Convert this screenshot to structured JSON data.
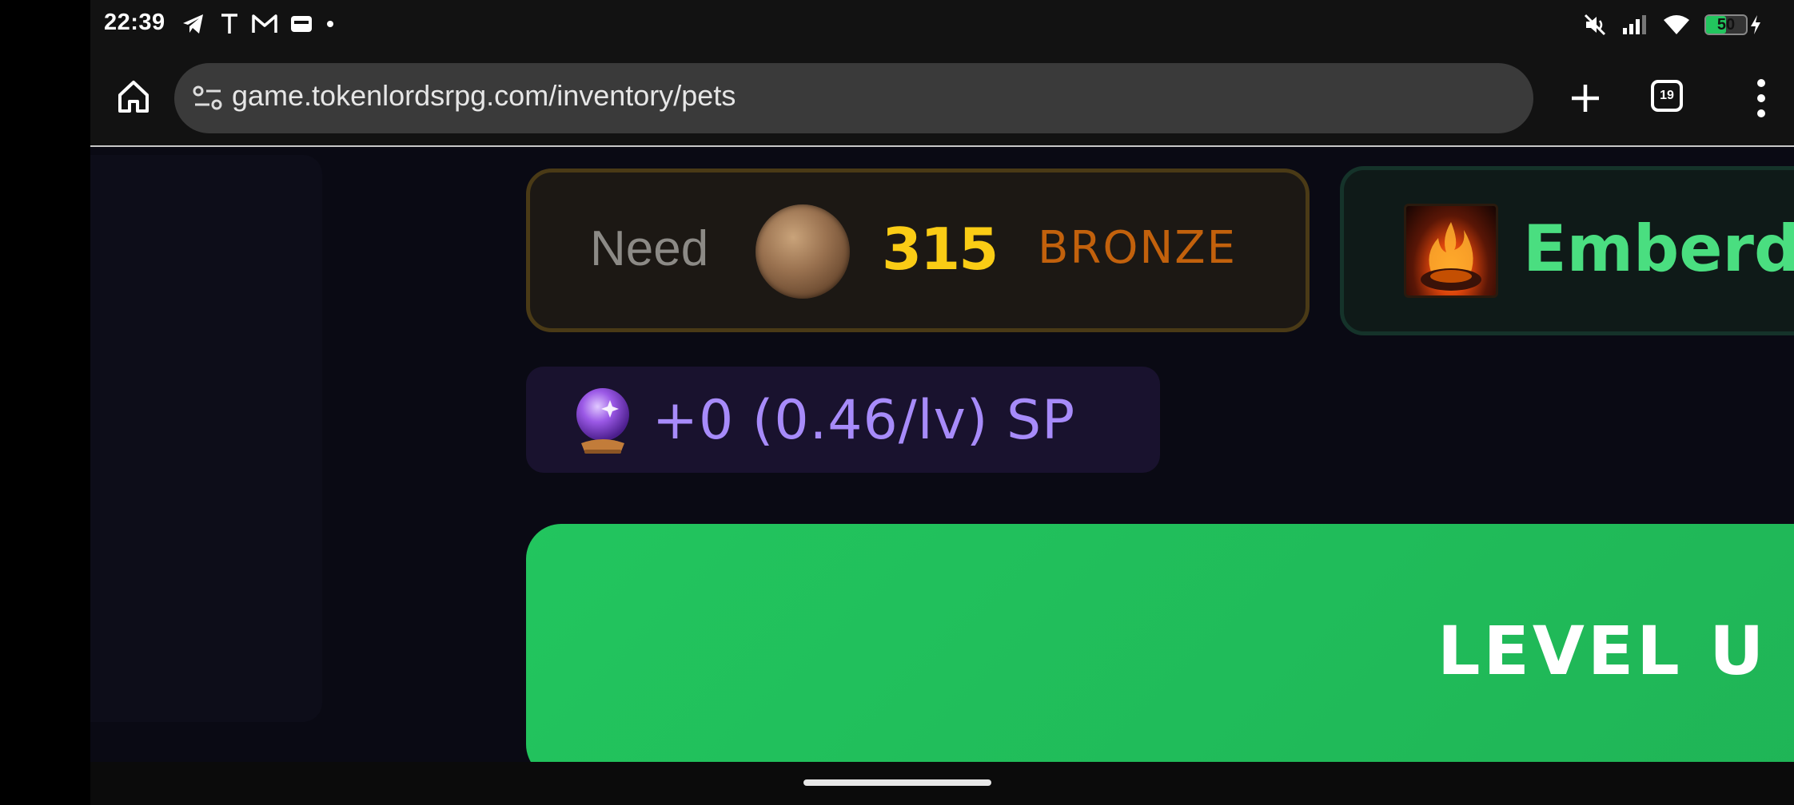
{
  "status_bar": {
    "time": "22:39",
    "notification_icons": [
      "telegram-icon",
      "t-app-icon",
      "gmail-icon",
      "wallet-icon",
      "dot-icon"
    ],
    "system_icons": [
      "mute-icon",
      "signal-icon",
      "wifi-icon",
      "battery-icon"
    ],
    "battery_level": "50",
    "battery_fraction": 0.5,
    "charging": true
  },
  "browser": {
    "url": "game.tokenlordsrpg.com/inventory/pets",
    "tab_count": "19"
  },
  "cost": {
    "label": "Need",
    "amount": "315",
    "currency": "BRONZE",
    "coin_icon": "bronze-coin-icon"
  },
  "pet": {
    "name": "Emberd",
    "image_icon": "ember-pet-portrait"
  },
  "sp": {
    "text": "+0 (0.46/lv) SP",
    "icon": "crystal-ball-icon"
  },
  "level_up": {
    "label": "LEVEL U"
  },
  "colors": {
    "accent_green": "#22c55e",
    "gold": "#facc15",
    "bronze": "#c2610c",
    "sp_purple": "#a78bfa"
  }
}
